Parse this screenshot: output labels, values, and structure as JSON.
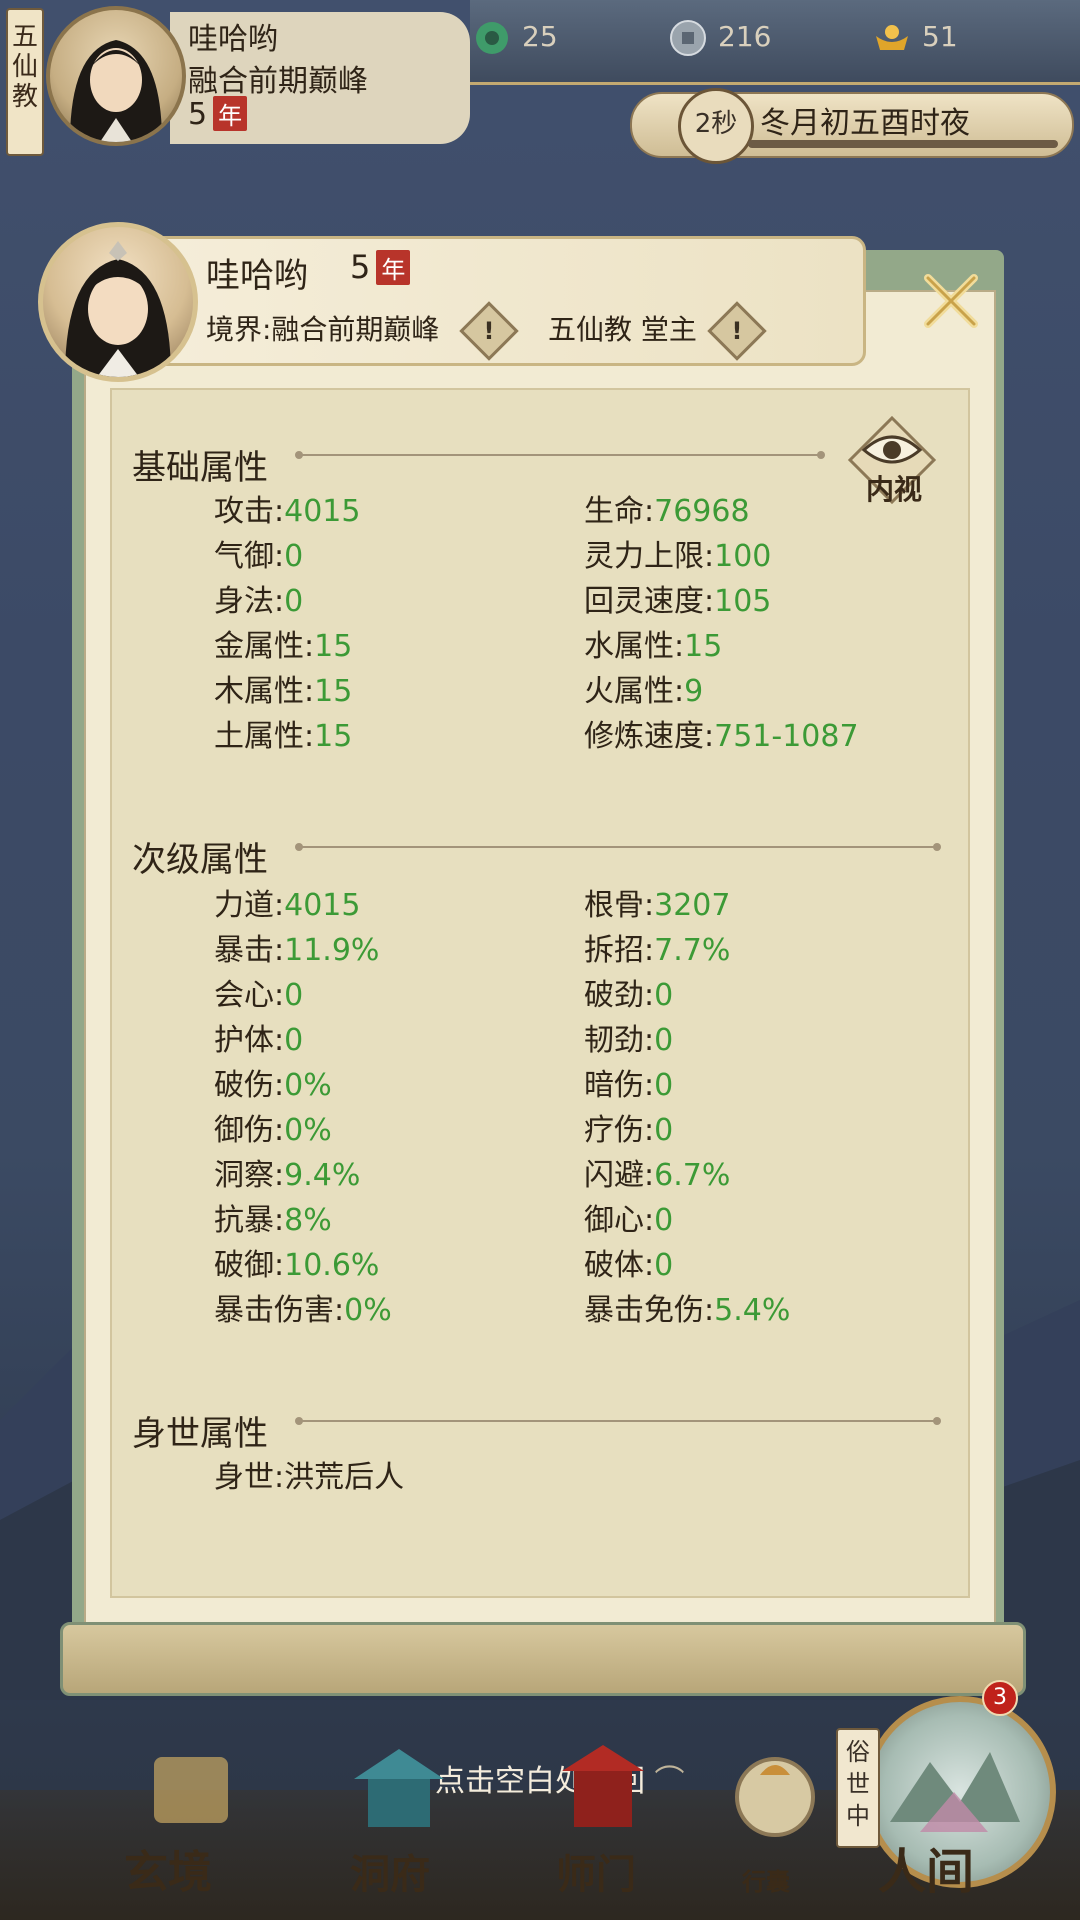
{
  "hud": {
    "sect_vertical": "五\n仙\n教",
    "name": "哇哈哟",
    "realm": "融合前期巅峰",
    "age": "5",
    "age_unit": "年",
    "resources": [
      {
        "icon": "jade-icon",
        "value": "25"
      },
      {
        "icon": "coin-icon",
        "value": "216"
      },
      {
        "icon": "ingot-icon",
        "value": "51"
      }
    ],
    "time_seconds": "2秒",
    "time_text": "冬月初五酉时夜"
  },
  "dialog": {
    "name": "哇哈哟",
    "age": "5",
    "age_unit": "年",
    "realm_label": "境界:融合前期巅峰",
    "sect_label": "五仙教 堂主",
    "inspect_label": "内视",
    "sections": {
      "basic": {
        "title": "基础属性",
        "left": [
          {
            "label": "攻击",
            "value": "4015"
          },
          {
            "label": "气御",
            "value": "0"
          },
          {
            "label": "身法",
            "value": "0"
          },
          {
            "label": "金属性",
            "value": "15"
          },
          {
            "label": "木属性",
            "value": "15"
          },
          {
            "label": "土属性",
            "value": "15"
          }
        ],
        "right": [
          {
            "label": "生命",
            "value": "76968"
          },
          {
            "label": "灵力上限",
            "value": "100"
          },
          {
            "label": "回灵速度",
            "value": "105"
          },
          {
            "label": "水属性",
            "value": "15"
          },
          {
            "label": "火属性",
            "value": "9"
          },
          {
            "label": "修炼速度",
            "value": "751-1087"
          }
        ]
      },
      "secondary": {
        "title": "次级属性",
        "left": [
          {
            "label": "力道",
            "value": "4015"
          },
          {
            "label": "暴击",
            "value": "11.9%"
          },
          {
            "label": "会心",
            "value": "0"
          },
          {
            "label": "护体",
            "value": "0"
          },
          {
            "label": "破伤",
            "value": "0%"
          },
          {
            "label": "御伤",
            "value": "0%"
          },
          {
            "label": "洞察",
            "value": "9.4%"
          },
          {
            "label": "抗暴",
            "value": "8%"
          },
          {
            "label": "破御",
            "value": "10.6%"
          },
          {
            "label": "暴击伤害",
            "value": "0%"
          }
        ],
        "right": [
          {
            "label": "根骨",
            "value": "3207"
          },
          {
            "label": "拆招",
            "value": "7.7%"
          },
          {
            "label": "破劲",
            "value": "0"
          },
          {
            "label": "韧劲",
            "value": "0"
          },
          {
            "label": "暗伤",
            "value": "0"
          },
          {
            "label": "疗伤",
            "value": "0"
          },
          {
            "label": "闪避",
            "value": "6.7%"
          },
          {
            "label": "御心",
            "value": "0"
          },
          {
            "label": "破体",
            "value": "0"
          },
          {
            "label": "暴击免伤",
            "value": "5.4%"
          }
        ]
      },
      "background": {
        "title": "身世属性",
        "items": [
          {
            "label": "身世",
            "value": "洪荒后人"
          }
        ]
      }
    }
  },
  "bottom": {
    "hint": "点击空白处返回",
    "nav": [
      {
        "label": "玄境",
        "icon": "scroll-icon"
      },
      {
        "label": "洞府",
        "icon": "pavilion-icon"
      },
      {
        "label": "师门",
        "icon": "sect-gate-icon"
      },
      {
        "label": "行囊",
        "icon": "bag-icon"
      },
      {
        "label": "人间",
        "icon": "world-icon"
      }
    ],
    "world_status": "俗\n世\n中",
    "world_badge": "3"
  },
  "colors": {
    "value_green": "#3c9a36",
    "paper": "#e7dfbf",
    "frame_green": "#93a889",
    "age_badge_red": "#b8342a"
  }
}
